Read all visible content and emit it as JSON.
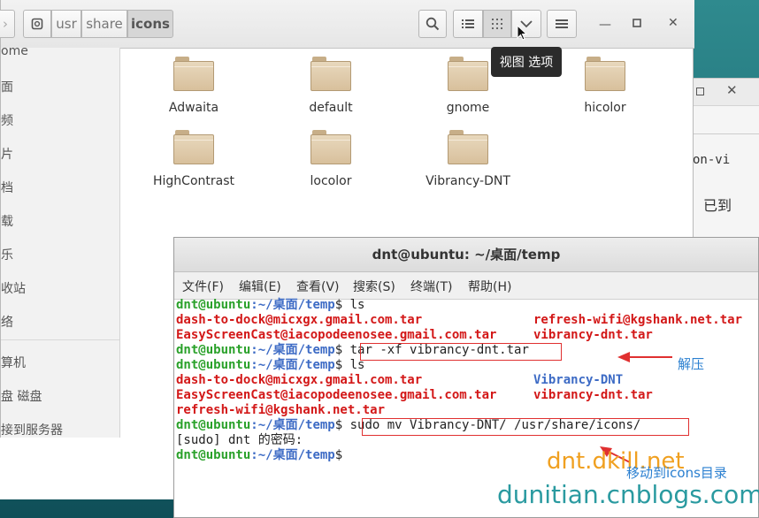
{
  "nautilus": {
    "path": [
      "usr",
      "share",
      "icons"
    ],
    "tooltip": "视图 选项",
    "sidebar": [
      "ome",
      "面",
      "频",
      "片",
      "档",
      "载",
      "乐",
      "收站",
      "络",
      "算机",
      "盘 磁盘",
      "接到服务器"
    ],
    "folders": [
      "Adwaita",
      "default",
      "gnome",
      "hicolor",
      "HighContrast",
      "locolor",
      "Vibrancy-DNT"
    ]
  },
  "background_window": {
    "text1": "on-vi",
    "text2": "已到"
  },
  "terminal": {
    "title": "dnt@ubuntu: ~/桌面/temp",
    "menu": [
      "文件(F)",
      "编辑(E)",
      "查看(V)",
      "搜索(S)",
      "终端(T)",
      "帮助(H)"
    ],
    "prompt_user": "dnt@ubuntu",
    "prompt_path": ":~/桌面/temp",
    "cmd1": " ls",
    "ls1": [
      {
        "a": "dash-to-dock@micxgx.gmail.com.tar",
        "b": "refresh-wifi@kgshank.net.tar"
      },
      {
        "a": "EasyScreenCast@iacopodeenosee.gmail.com.tar",
        "b": "vibrancy-dnt.tar"
      }
    ],
    "cmd2": " tar -xf vibrancy-dnt.tar",
    "cmd3": " ls",
    "ls2": [
      {
        "a": "dash-to-dock@micxgx.gmail.com.tar",
        "b": "Vibrancy-DNT"
      },
      {
        "a": "EasyScreenCast@iacopodeenosee.gmail.com.tar",
        "b": "vibrancy-dnt.tar"
      }
    ],
    "ls2_last": "refresh-wifi@kgshank.net.tar",
    "cmd4": " sudo mv Vibrancy-DNT/ /usr/share/icons/",
    "sudo_prompt": "[sudo] dnt 的密码:"
  },
  "annotations": {
    "extract": "解压",
    "move": "移动到icons目录",
    "watermark1": "dnt.dkill.net",
    "watermark2": "dunitian.cnblogs.com"
  },
  "colors": {
    "accent_red": "#e03030",
    "prompt_green": "#2aa12a",
    "prompt_blue": "#3d6bc5",
    "watermark_orange": "#f0a020",
    "watermark_teal": "#2a9aa0"
  }
}
